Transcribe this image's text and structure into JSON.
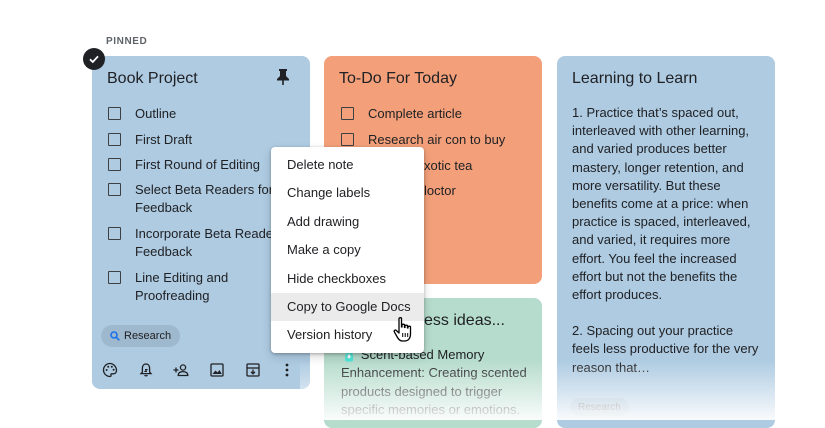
{
  "section_label": "PINNED",
  "colors": {
    "blue_card": "#aecbe2",
    "orange_card": "#f3a07a",
    "green_card": "#b6dccd",
    "menu_hover": "#ebebeb"
  },
  "book_card": {
    "title": "Book Project",
    "items": [
      {
        "text": "Outline"
      },
      {
        "text": "First Draft"
      },
      {
        "text": "First Round of Editing"
      },
      {
        "text": "Select Beta Readers for\nFeedback"
      },
      {
        "text": "Incorporate Beta Readers\nFeedback"
      },
      {
        "text": "Line Editing and\nProofreading"
      }
    ],
    "label_chip": "Research",
    "toolbar_icons": [
      "palette-icon",
      "reminder-bell-icon",
      "add-collaborator-icon",
      "image-icon",
      "archive-icon",
      "more-vert-icon"
    ]
  },
  "todo_card": {
    "title": "To-Do For Today",
    "items": [
      {
        "text": "Complete article"
      },
      {
        "text": "Research air con to buy"
      },
      {
        "text": "xotic tea"
      },
      {
        "text": "loctor"
      }
    ]
  },
  "ideas_card": {
    "title": "ess ideas...",
    "body": "🧴 Scent-based Memory Enhancement: Creating scented products designed to trigger specific memories or emotions."
  },
  "learning_card": {
    "title": "Learning to Learn",
    "paragraphs": [
      "1. Practice that’s spaced out, interleaved with other learning, and varied produces better mastery, longer retention, and more versatility. But these benefits come at a price: when practice is spaced, interleaved, and varied, it requires more effort. You feel the increased effort but not the benefits the effort produces.",
      "2. Spacing out your practice feels less productive for the very reason that…"
    ],
    "label_chip": "Research"
  },
  "context_menu": {
    "items": [
      "Delete note",
      "Change labels",
      "Add drawing",
      "Make a copy",
      "Hide checkboxes",
      "Copy to Google Docs",
      "Version history"
    ],
    "hovered_index": 5
  }
}
